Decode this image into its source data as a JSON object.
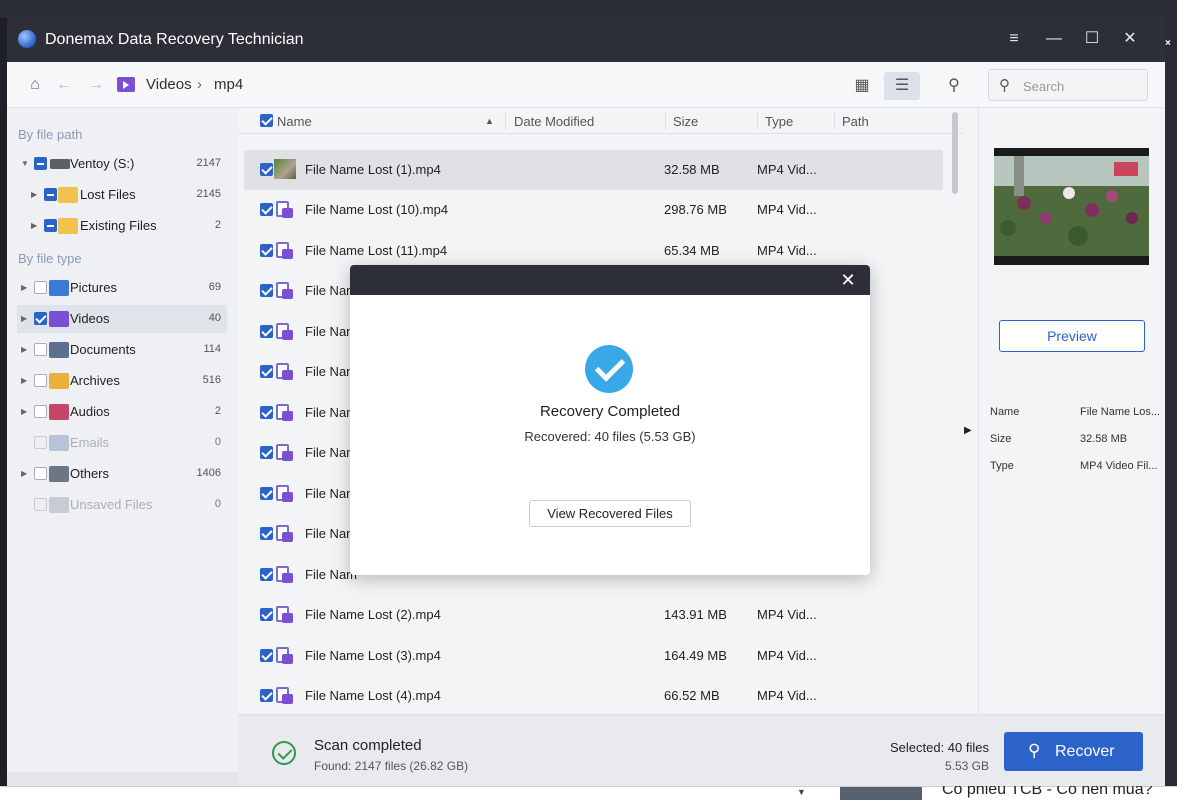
{
  "window": {
    "title": "Donemax Data Recovery  Technician"
  },
  "breadcrumb": {
    "folder": "Videos",
    "separator": "›",
    "subfolder": "mp4"
  },
  "search": {
    "placeholder": "Search"
  },
  "sidebar": {
    "by_path_heading": "By file path",
    "path_items": [
      {
        "label": "Ventoy (S:)",
        "count": "2147",
        "check": "partial"
      },
      {
        "label": "Lost Files",
        "count": "2145",
        "check": "partial"
      },
      {
        "label": "Existing Files",
        "count": "2",
        "check": "partial"
      }
    ],
    "by_type_heading": "By file type",
    "type_items": [
      {
        "label": "Pictures",
        "count": "69",
        "check": "off"
      },
      {
        "label": "Videos",
        "count": "40",
        "check": "on"
      },
      {
        "label": "Documents",
        "count": "114",
        "check": "off"
      },
      {
        "label": "Archives",
        "count": "516",
        "check": "off"
      },
      {
        "label": "Audios",
        "count": "2",
        "check": "off"
      },
      {
        "label": "Emails",
        "count": "0",
        "check": "disabled"
      },
      {
        "label": "Others",
        "count": "1406",
        "check": "off"
      },
      {
        "label": "Unsaved Files",
        "count": "0",
        "check": "disabled"
      }
    ]
  },
  "table": {
    "columns": [
      "Name",
      "Date Modified",
      "Size",
      "Type",
      "Path"
    ],
    "rows": [
      {
        "name": "File Name Lost (1).mp4",
        "size": "32.58 MB",
        "type": "MP4 Vid..."
      },
      {
        "name": "File Name Lost (10).mp4",
        "size": "298.76 MB",
        "type": "MP4 Vid..."
      },
      {
        "name": "File Name Lost (11).mp4",
        "size": "65.34 MB",
        "type": "MP4 Vid..."
      },
      {
        "name": "File Nam",
        "size": "",
        "type": ""
      },
      {
        "name": "File Nam",
        "size": "",
        "type": ""
      },
      {
        "name": "File Nam",
        "size": "",
        "type": ""
      },
      {
        "name": "File Nam",
        "size": "",
        "type": ""
      },
      {
        "name": "File Nam",
        "size": "",
        "type": ""
      },
      {
        "name": "File Nam",
        "size": "",
        "type": ""
      },
      {
        "name": "File Nam",
        "size": "",
        "type": ""
      },
      {
        "name": "File Nam",
        "size": "",
        "type": ""
      },
      {
        "name": "File Name Lost (2).mp4",
        "size": "143.91 MB",
        "type": "MP4 Vid..."
      },
      {
        "name": "File Name Lost (3).mp4",
        "size": "164.49 MB",
        "type": "MP4 Vid..."
      },
      {
        "name": "File Name Lost (4).mp4",
        "size": "66.52 MB",
        "type": "MP4 Vid..."
      }
    ]
  },
  "preview": {
    "button": "Preview",
    "props": [
      {
        "key": "Name",
        "value": "File Name Los..."
      },
      {
        "key": "Size",
        "value": "32.58 MB"
      },
      {
        "key": "Type",
        "value": "MP4 Video Fil..."
      }
    ]
  },
  "status": {
    "title": "Scan completed",
    "found": "Found: 2147 files (26.82 GB)",
    "selected_label": "Selected: 40 files",
    "selected_size": "5.53 GB",
    "recover_button": "Recover"
  },
  "dialog": {
    "title": "Recovery Completed",
    "subtitle": "Recovered: 40 files (5.53 GB)",
    "button": "View Recovered Files"
  },
  "background": {
    "news_text": "Có phiếu TCB - Có nên mua?"
  },
  "colors": {
    "accent": "#2b63c9",
    "titlebar": "#2d2f38",
    "video_purple": "#7b4fd3",
    "success_green": "#2e9a4d",
    "dialog_check": "#38a8e8"
  }
}
